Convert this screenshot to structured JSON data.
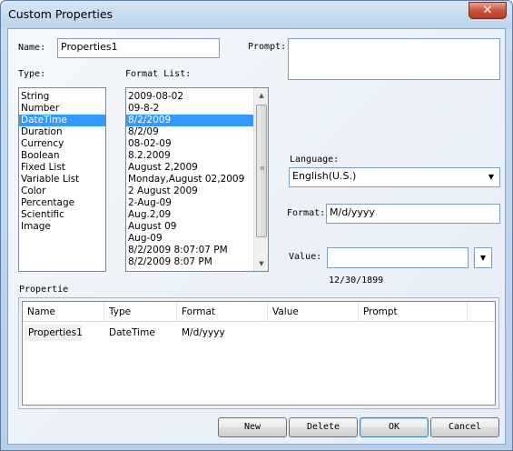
{
  "window": {
    "title": "Custom Properties",
    "close_label": "✕"
  },
  "name": {
    "label": "Name:",
    "value": "Properties1"
  },
  "prompt": {
    "label": "Prompt:",
    "value": ""
  },
  "type": {
    "label": "Type:",
    "items": [
      "String",
      "Number",
      "DateTime",
      "Duration",
      "Currency",
      "Boolean",
      "Fixed List",
      "Variable List",
      "Color",
      "Percentage",
      "Scientific",
      "Image"
    ],
    "selected_index": 2
  },
  "format_list": {
    "label": "Format List:",
    "items": [
      "2009-08-02",
      "09-8-2",
      "8/2/2009",
      "8/2/09",
      "08-02-09",
      "8.2.2009",
      "August 2,2009",
      "Monday,August 02,2009",
      "2 August 2009",
      "2-Aug-09",
      "Aug.2,09",
      "August 09",
      "Aug-09",
      "8/2/2009 8:07:07 PM",
      "8/2/2009 8:07 PM"
    ],
    "selected_index": 2
  },
  "language": {
    "label": "Language:",
    "value": "English(U.S.)"
  },
  "format": {
    "label": "Format:",
    "value": "M/d/yyyy"
  },
  "value": {
    "label": "Value:",
    "value": "",
    "preview": "12/30/1899"
  },
  "properties": {
    "label": "Propertie",
    "columns": [
      "Name",
      "Type",
      "Format",
      "Value",
      "Prompt"
    ],
    "rows": [
      {
        "name": "Properties1",
        "type": "DateTime",
        "format": "M/d/yyyy",
        "value": "",
        "prompt": ""
      }
    ]
  },
  "buttons": {
    "new": "New",
    "delete": "Delete",
    "ok": "OK",
    "cancel": "Cancel"
  },
  "icons": {
    "dropdown": "chevron-down-icon",
    "scroll_up": "scroll-up-icon",
    "scroll_down": "scroll-down-icon",
    "close": "close-icon"
  }
}
